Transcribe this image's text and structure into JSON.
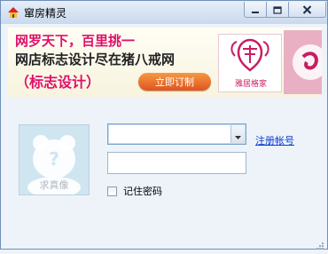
{
  "window": {
    "title": "窜房精灵",
    "icon": "app-house-icon"
  },
  "title_buttons": {
    "minimize_icon": "minimize-icon",
    "maximize_icon": "maximize-icon",
    "close_icon": "close-icon"
  },
  "banner": {
    "line1": "网罗天下，百里挑一",
    "line2": "网店标志设计尽在猪八戒网",
    "line3": "（标志设计）",
    "button_label": "立即订制",
    "logo_caption": "雅居格家",
    "accent_color": "#e0106a"
  },
  "login": {
    "avatar_text": "求真像",
    "account_value": "",
    "register_link": "注册帐号",
    "password_value": "",
    "remember_label": "记住密码",
    "remember_checked": false
  }
}
